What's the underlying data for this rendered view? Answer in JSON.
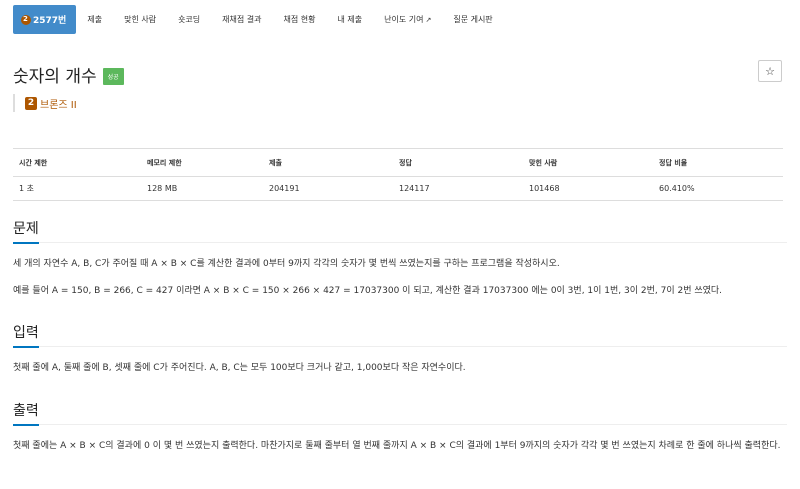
{
  "tabs": [
    {
      "label": "2577번",
      "active": true
    },
    {
      "label": "제출"
    },
    {
      "label": "맞힌 사람"
    },
    {
      "label": "숏코딩"
    },
    {
      "label": "재채점 결과"
    },
    {
      "label": "채점 현황"
    },
    {
      "label": "내 제출"
    },
    {
      "label": "난이도 기여"
    },
    {
      "label": "질문 게시판"
    }
  ],
  "problem": {
    "title": "숫자의 개수",
    "status": "성공",
    "star": "☆",
    "tier_number": "2",
    "tier_label": "브론즈 II",
    "tier_color": "#ad5600"
  },
  "table": {
    "headers": [
      "시간 제한",
      "메모리 제한",
      "제출",
      "정답",
      "맞힌 사람",
      "정답 비율"
    ],
    "row": [
      "1 초",
      "128 MB",
      "204191",
      "124117",
      "101468",
      "60.410%"
    ]
  },
  "sections": {
    "problem_head": "문제",
    "problem_p1": "세 개의 자연수 A, B, C가 주어질 때 A × B × C를 계산한 결과에 0부터 9까지 각각의 숫자가 몇 번씩 쓰였는지를 구하는 프로그램을 작성하시오.",
    "problem_p2": "예를 들어 A = 150, B = 266, C = 427 이라면 A × B × C = 150 × 266 × 427 = 17037300 이 되고, 계산한 결과 17037300 에는 0이 3번, 1이 1번, 3이 2번, 7이 2번 쓰였다.",
    "input_head": "입력",
    "input_p": "첫째 줄에 A, 둘째 줄에 B, 셋째 줄에 C가 주어진다. A, B, C는 모두 100보다 크거나 같고, 1,000보다 작은 자연수이다.",
    "output_head": "출력",
    "output_p": "첫째 줄에는 A × B × C의 결과에 0 이 몇 번 쓰였는지 출력한다. 마찬가지로 둘째 줄부터 열 번째 줄까지 A × B × C의 결과에 1부터 9까지의 숫자가 각각 몇 번 쓰였는지 차례로 한 줄에 하나씩 출력한다."
  },
  "colors": {
    "accent": "#428bca",
    "success": "#5cb85c",
    "heading_underline": "#0076c0"
  }
}
